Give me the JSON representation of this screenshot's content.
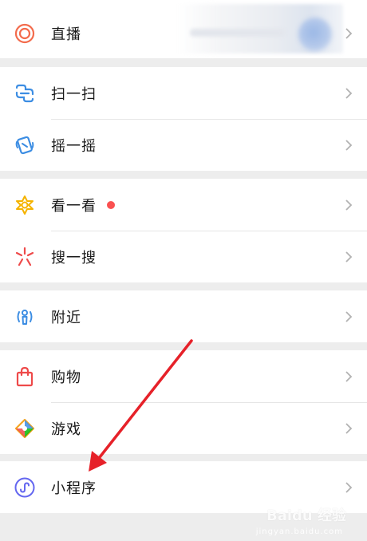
{
  "menu": {
    "live": {
      "label": "直播",
      "icon": "live-icon"
    },
    "scan": {
      "label": "扫一扫",
      "icon": "scan-icon"
    },
    "shake": {
      "label": "摇一摇",
      "icon": "shake-icon"
    },
    "top_stories": {
      "label": "看一看",
      "icon": "top-stories-icon",
      "badge_color": "#fa5151"
    },
    "search": {
      "label": "搜一搜",
      "icon": "search-icon"
    },
    "nearby": {
      "label": "附近",
      "icon": "nearby-icon"
    },
    "shopping": {
      "label": "购物",
      "icon": "shopping-bag-icon"
    },
    "games": {
      "label": "游戏",
      "icon": "game-icon"
    },
    "mini_programs": {
      "label": "小程序",
      "icon": "mini-program-icon"
    }
  },
  "annotation": {
    "arrow_color": "#e62129"
  },
  "watermark": {
    "text": "Baidu 经验",
    "sub": "jingyan.baidu.com"
  },
  "colors": {
    "background": "#ededed",
    "cell": "#ffffff",
    "text": "#191919",
    "chevron": "#b2b2b2"
  }
}
